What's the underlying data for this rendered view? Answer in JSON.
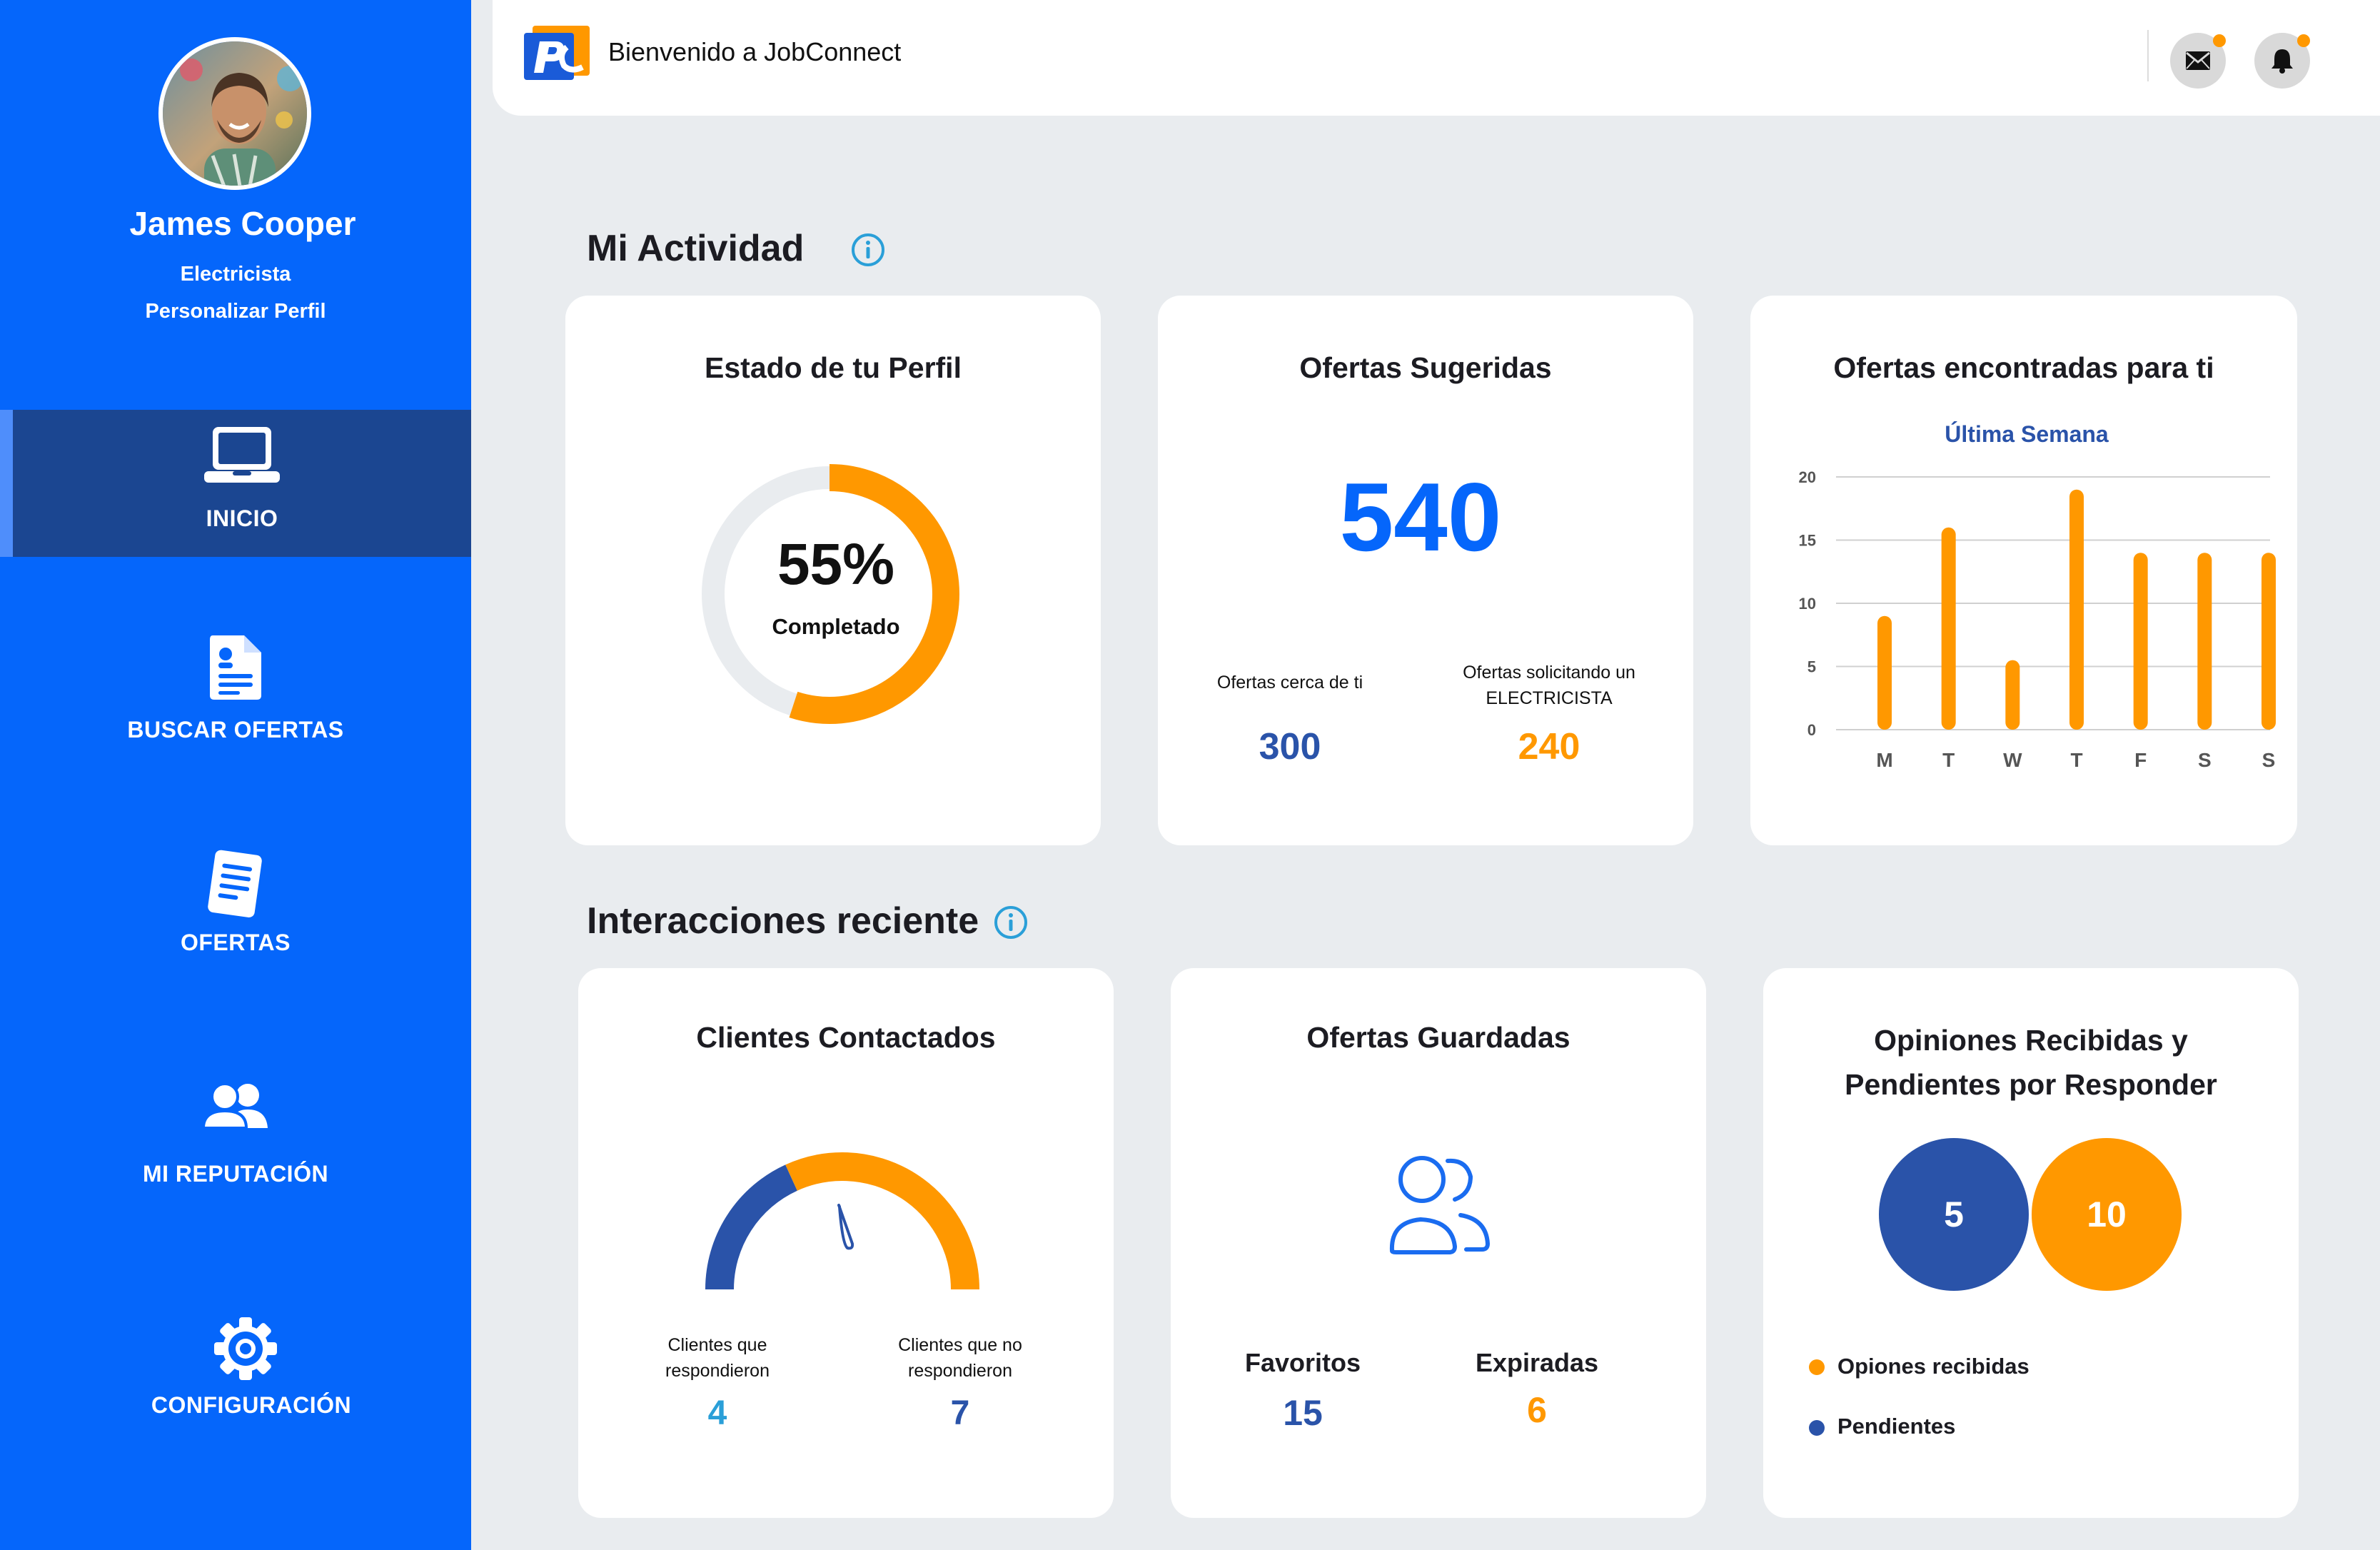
{
  "user": {
    "name": "James Cooper",
    "role": "Electricista",
    "customize_label": "Personalizar Perfil"
  },
  "nav": {
    "items": [
      {
        "label": "INICIO",
        "icon": "laptop-icon",
        "active": true
      },
      {
        "label": "BUSCAR OFERTAS",
        "icon": "document-icon"
      },
      {
        "label": "OFERTAS",
        "icon": "offers-icon"
      },
      {
        "label": "MI REPUTACIÓN",
        "icon": "users-icon"
      },
      {
        "label": "CONFIGURACIÓN",
        "icon": "gear-icon"
      }
    ]
  },
  "header": {
    "welcome": "Bienvenido a JobConnect",
    "icons": [
      "mail-icon",
      "bell-icon"
    ]
  },
  "activity": {
    "title": "Mi Actividad",
    "profile": {
      "title": "Estado de tu Perfil",
      "percent_text": "55%",
      "percent_value": 55,
      "status": "Completado"
    },
    "suggested": {
      "title": "Ofertas Sugeridas",
      "total": "540",
      "near_label": "Ofertas cerca de ti",
      "near_value": "300",
      "requesting_label": "Ofertas solicitando un ELECTRICISTA",
      "requesting_value": "240"
    },
    "found": {
      "title": "Ofertas encontradas para ti",
      "subtitle": "Última Semana"
    }
  },
  "chart_data": {
    "type": "bar",
    "title": "Ofertas encontradas para ti",
    "subtitle": "Última Semana",
    "categories": [
      "M",
      "T",
      "W",
      "T",
      "F",
      "S",
      "S"
    ],
    "values": [
      9,
      16,
      5.5,
      19,
      14,
      14,
      14
    ],
    "yticks": [
      0,
      5,
      10,
      15,
      20
    ],
    "ylim": [
      0,
      20
    ],
    "grid": true,
    "color": "#ff9800"
  },
  "interactions": {
    "title": "Interacciones reciente",
    "contacted": {
      "title": "Clientes Contactados",
      "responded_label": "Clientes que respondieron",
      "responded_value": "4",
      "not_responded_label": "Clientes que no respondieron",
      "not_responded_value": "7"
    },
    "saved": {
      "title": "Ofertas Guardadas",
      "favorites_label": "Favoritos",
      "favorites_value": "15",
      "expired_label": "Expiradas",
      "expired_value": "6"
    },
    "reviews": {
      "title_line1": "Opiniones Recibidas y",
      "title_line2": "Pendientes por Responder",
      "pending_value": "5",
      "received_value": "10",
      "legend_received": "Opiones recibidas",
      "legend_pending": "Pendientes"
    }
  },
  "colors": {
    "primary": "#0566fb",
    "navy": "#2a53a9",
    "orange": "#ff9800",
    "light_blue": "#2a9fd8"
  }
}
